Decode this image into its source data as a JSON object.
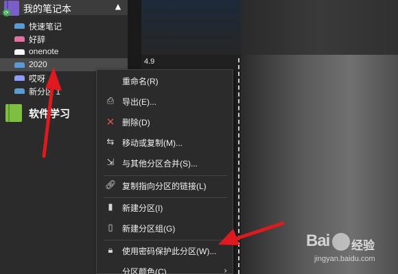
{
  "notebook": {
    "title": "我的笔记本",
    "icon": "notebook-icon",
    "color": "#7b5fc9",
    "sync_icon": "sync-icon",
    "chevron_icon": "chevron-up-icon"
  },
  "sections": [
    {
      "label": "快速笔记",
      "color": "#5b9bd5",
      "selected": false
    },
    {
      "label": "好辞",
      "color": "#e56fa3",
      "selected": false
    },
    {
      "label": "onenote",
      "color": "#f5f5f5",
      "selected": false
    },
    {
      "label": "2020",
      "color": "#5b9bd5",
      "selected": true
    },
    {
      "label": "哎呀",
      "color": "#8f9df5",
      "selected": false
    },
    {
      "label": "新分区 1",
      "color": "#5b9bd5",
      "selected": false
    }
  ],
  "notebook2": {
    "title": "软件学习",
    "icon": "notebook-icon",
    "color": "#7dbf41"
  },
  "page": {
    "date": "4.9"
  },
  "context_menu": {
    "items": [
      {
        "label": "重命名(R)",
        "icon": ""
      },
      {
        "label": "导出(E)...",
        "icon": "export-icon"
      },
      {
        "label": "删除(D)",
        "icon": "delete-icon"
      },
      {
        "label": "移动或复制(M)...",
        "icon": "move-copy-icon"
      },
      {
        "label": "与其他分区合并(S)...",
        "icon": "merge-icon"
      },
      {
        "label": "复制指向分区的链接(L)",
        "icon": "link-icon"
      },
      {
        "label": "新建分区(I)",
        "icon": "new-section-icon"
      },
      {
        "label": "新建分区组(G)",
        "icon": "new-section-group-icon"
      },
      {
        "label": "使用密码保护此分区(W)...",
        "icon": "lock-icon"
      },
      {
        "label": "分区颜色(C)",
        "icon": "color-icon"
      }
    ]
  },
  "watermark": {
    "logo": "Bai",
    "text": "经验",
    "url": "jingyan.baidu.com"
  },
  "colors": {
    "annotation_arrow": "#e0191f",
    "menu_background": "#2b2b2b",
    "sidebar_background": "#2b2b2b"
  }
}
